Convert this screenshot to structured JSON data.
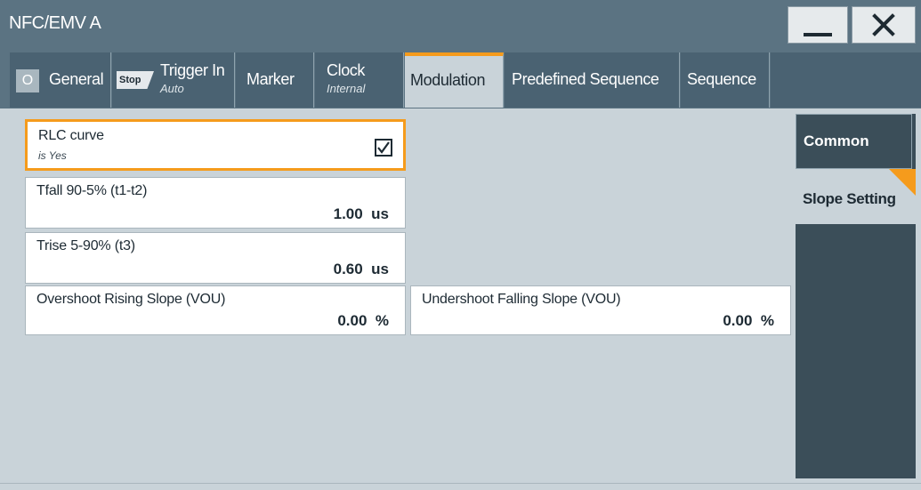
{
  "window": {
    "title": "NFC/EMV A",
    "minimize_icon": "minimize-icon",
    "close_glyph": "✕"
  },
  "tabs": {
    "general": {
      "badge": "O",
      "label": "General"
    },
    "trigger": {
      "badge": "Stop",
      "label": "Trigger In",
      "sub": "Auto"
    },
    "marker": {
      "label": "Marker"
    },
    "clock": {
      "label": "Clock",
      "sub": "Internal"
    },
    "modulation": {
      "label": "Modulation"
    },
    "predefined": {
      "label": "Predefined Sequence"
    },
    "sequence": {
      "label": "Sequence"
    }
  },
  "fields": {
    "rlc": {
      "label": "RLC curve",
      "sub": "is Yes",
      "checked": true
    },
    "tfall": {
      "label": "Tfall 90-5% (t1-t2)",
      "value": "1.00",
      "unit": "us"
    },
    "trise": {
      "label": "Trise 5-90% (t3)",
      "value": "0.60",
      "unit": "us"
    },
    "overshoot": {
      "label": "Overshoot Rising Slope (VOU)",
      "value": "0.00",
      "unit": "%"
    },
    "undershoot": {
      "label": "Undershoot Falling Slope (VOU)",
      "value": "0.00",
      "unit": "%"
    }
  },
  "side": {
    "common": "Common",
    "slope": "Slope Setting"
  },
  "colors": {
    "accent": "#f59b1c",
    "titlebar": "#5b7382",
    "panel": "#3b4e59",
    "content": "#c9d3d9"
  }
}
